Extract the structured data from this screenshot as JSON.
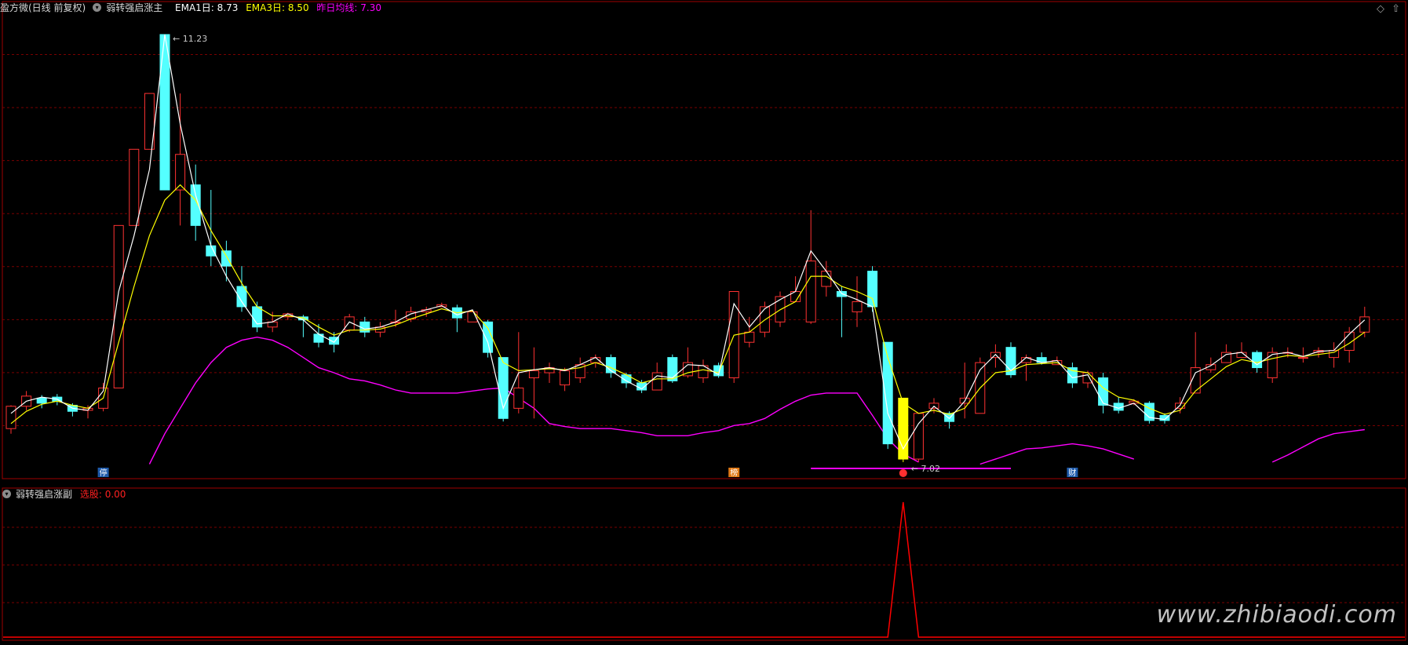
{
  "header": {
    "app_name": "盈方微(日线 前复权)",
    "main_indicator_name": "弱转强启涨主",
    "ema1_label": "EMA1日: 8.73",
    "ema3_label": "EMA3日: 8.50",
    "prev_avg_label": "昨日均线: 7.30"
  },
  "sub_header": {
    "indicator_name": "弱转强启涨副",
    "value_label": "选股: 0.00"
  },
  "watermark": "www.zhibiaodi.com",
  "colors": {
    "up": "#ff3232",
    "down": "#54ffff",
    "signal_bar": "#ffff00",
    "ema1": "#ffffff",
    "ema3": "#ffff00",
    "avg": "#ff00ff",
    "grid": "#7a0000",
    "sub_signal": "#ff0000",
    "marker_blue": "#1e5aaa",
    "marker_orange": "#e07814"
  },
  "chart_data": [
    {
      "type": "candlestick",
      "title": "弱转强启涨主",
      "annotations": [
        {
          "text": "11.23",
          "at_index": 10,
          "kind": "max"
        },
        {
          "text": "7.02",
          "at_index": 58,
          "kind": "min"
        }
      ],
      "markers": [
        {
          "text": "停",
          "at_index": 6,
          "style": "blue"
        },
        {
          "text": "榜",
          "at_index": 47,
          "style": "orange"
        },
        {
          "text": "财",
          "at_index": 69,
          "style": "blue"
        }
      ],
      "signal_line": {
        "value": 7.02,
        "from_index": 52,
        "to_index": 65
      },
      "ylim": [
        6.95,
        11.4
      ],
      "candles": [
        [
          7.35,
          7.57,
          7.3,
          7.58
        ],
        [
          7.57,
          7.67,
          7.53,
          7.72
        ],
        [
          7.65,
          7.6,
          7.55,
          7.68
        ],
        [
          7.66,
          7.62,
          7.58,
          7.69
        ],
        [
          7.58,
          7.52,
          7.47,
          7.6
        ],
        [
          7.53,
          7.55,
          7.45,
          7.58
        ],
        [
          7.55,
          7.75,
          7.52,
          7.8
        ],
        [
          7.75,
          9.35,
          7.75,
          9.35
        ],
        [
          9.35,
          10.1,
          9.35,
          10.1
        ],
        [
          10.1,
          10.65,
          10.1,
          10.65
        ],
        [
          11.23,
          9.7,
          9.7,
          11.23
        ],
        [
          9.7,
          10.05,
          9.35,
          10.65
        ],
        [
          9.75,
          9.35,
          9.2,
          9.95
        ],
        [
          9.15,
          9.05,
          8.95,
          9.7
        ],
        [
          9.1,
          8.95,
          8.8,
          9.2
        ],
        [
          8.75,
          8.55,
          8.5,
          8.95
        ],
        [
          8.55,
          8.35,
          8.3,
          8.6
        ],
        [
          8.35,
          8.4,
          8.3,
          8.5
        ],
        [
          8.45,
          8.48,
          8.42,
          8.49
        ],
        [
          8.45,
          8.42,
          8.25,
          8.47
        ],
        [
          8.28,
          8.2,
          8.15,
          8.38
        ],
        [
          8.25,
          8.18,
          8.1,
          8.3
        ],
        [
          8.32,
          8.45,
          8.3,
          8.48
        ],
        [
          8.4,
          8.3,
          8.25,
          8.45
        ],
        [
          8.3,
          8.35,
          8.25,
          8.4
        ],
        [
          8.4,
          8.4,
          8.35,
          8.52
        ],
        [
          8.43,
          8.5,
          8.4,
          8.55
        ],
        [
          8.5,
          8.52,
          8.45,
          8.55
        ],
        [
          8.55,
          8.57,
          8.55,
          8.59
        ],
        [
          8.54,
          8.44,
          8.3,
          8.57
        ],
        [
          8.4,
          8.5,
          8.42,
          8.52
        ],
        [
          8.4,
          8.1,
          8.05,
          8.42
        ],
        [
          8.05,
          7.45,
          7.42,
          8.05
        ],
        [
          7.55,
          7.75,
          7.5,
          8.3
        ],
        [
          7.85,
          7.92,
          7.45,
          8.15
        ],
        [
          7.9,
          7.95,
          7.8,
          8.0
        ],
        [
          7.78,
          7.92,
          7.72,
          7.95
        ],
        [
          7.85,
          7.98,
          7.8,
          8.05
        ],
        [
          8.0,
          8.05,
          7.95,
          8.08
        ],
        [
          8.05,
          7.9,
          7.85,
          8.08
        ],
        [
          7.88,
          7.8,
          7.75,
          7.9
        ],
        [
          7.8,
          7.73,
          7.7,
          7.83
        ],
        [
          7.73,
          7.9,
          7.73,
          8.0
        ],
        [
          8.05,
          7.82,
          7.8,
          8.08
        ],
        [
          7.87,
          8.0,
          7.85,
          8.15
        ],
        [
          7.85,
          7.97,
          7.8,
          8.03
        ],
        [
          7.97,
          7.87,
          7.85,
          8.0
        ],
        [
          7.85,
          8.7,
          7.8,
          8.7
        ],
        [
          8.2,
          8.3,
          8.15,
          8.45
        ],
        [
          8.3,
          8.55,
          8.25,
          8.6
        ],
        [
          8.4,
          8.65,
          8.35,
          8.7
        ],
        [
          8.6,
          8.7,
          8.65,
          8.85
        ],
        [
          8.4,
          9.0,
          8.38,
          9.5
        ],
        [
          8.75,
          8.9,
          8.65,
          9.0
        ],
        [
          8.7,
          8.65,
          8.25,
          8.75
        ],
        [
          8.5,
          8.6,
          8.35,
          8.85
        ],
        [
          8.9,
          8.55,
          8.5,
          8.95
        ],
        [
          8.2,
          7.2,
          7.15,
          8.2
        ],
        [
          7.65,
          7.05,
          7.02,
          7.65
        ],
        [
          7.05,
          7.5,
          7.02,
          7.5
        ],
        [
          7.55,
          7.6,
          7.5,
          7.65
        ],
        [
          7.5,
          7.42,
          7.35,
          7.52
        ],
        [
          7.6,
          7.65,
          7.45,
          8.0
        ],
        [
          7.5,
          8.0,
          7.5,
          8.05
        ],
        [
          8.05,
          8.1,
          7.95,
          8.18
        ],
        [
          8.15,
          7.88,
          7.85,
          8.2
        ],
        [
          8.0,
          8.05,
          7.82,
          8.08
        ],
        [
          8.05,
          8.0,
          7.98,
          8.1
        ],
        [
          7.98,
          8.02,
          7.98,
          8.06
        ],
        [
          7.95,
          7.8,
          7.75,
          8.0
        ],
        [
          7.8,
          7.9,
          7.75,
          7.92
        ],
        [
          7.85,
          7.58,
          7.5,
          7.9
        ],
        [
          7.6,
          7.53,
          7.5,
          7.66
        ],
        [
          7.6,
          7.62,
          7.58,
          7.64
        ],
        [
          7.6,
          7.43,
          7.4,
          7.62
        ],
        [
          7.48,
          7.43,
          7.4,
          7.5
        ],
        [
          7.55,
          7.6,
          7.5,
          7.66
        ],
        [
          7.7,
          7.95,
          7.7,
          8.3
        ],
        [
          7.93,
          7.98,
          7.9,
          8.05
        ],
        [
          8.0,
          8.1,
          8.0,
          8.18
        ],
        [
          8.05,
          8.1,
          8.05,
          8.2
        ],
        [
          8.1,
          7.95,
          7.9,
          8.12
        ],
        [
          7.85,
          8.1,
          7.8,
          8.15
        ],
        [
          8.1,
          8.1,
          8.05,
          8.15
        ],
        [
          8.05,
          8.05,
          8.0,
          8.15
        ],
        [
          8.1,
          8.12,
          8.05,
          8.15
        ],
        [
          8.05,
          8.12,
          7.95,
          8.2
        ],
        [
          8.12,
          8.3,
          8.0,
          8.35
        ],
        [
          8.3,
          8.45,
          8.25,
          8.55
        ]
      ],
      "ema1": [
        7.5,
        7.62,
        7.66,
        7.64,
        7.55,
        7.53,
        7.72,
        8.7,
        9.25,
        9.9,
        11.23,
        10.35,
        9.65,
        9.15,
        8.85,
        8.6,
        8.38,
        8.4,
        8.48,
        8.42,
        8.28,
        8.2,
        8.4,
        8.33,
        8.35,
        8.4,
        8.48,
        8.52,
        8.56,
        8.47,
        8.52,
        8.2,
        7.55,
        7.9,
        7.93,
        7.95,
        7.92,
        7.98,
        8.05,
        7.92,
        7.82,
        7.74,
        7.87,
        7.85,
        7.98,
        7.97,
        7.88,
        8.58,
        8.35,
        8.53,
        8.62,
        8.7,
        9.1,
        8.9,
        8.68,
        8.62,
        8.55,
        7.5,
        7.15,
        7.4,
        7.57,
        7.45,
        7.62,
        7.93,
        8.08,
        7.92,
        8.05,
        8.0,
        8.02,
        7.85,
        7.88,
        7.6,
        7.55,
        7.6,
        7.46,
        7.44,
        7.58,
        7.9,
        7.97,
        8.08,
        8.1,
        7.98,
        8.08,
        8.1,
        8.06,
        8.11,
        8.12,
        8.28,
        8.42
      ],
      "ema3": [
        7.4,
        7.52,
        7.59,
        7.62,
        7.58,
        7.55,
        7.65,
        8.2,
        8.75,
        9.25,
        9.6,
        9.75,
        9.6,
        9.3,
        9.05,
        8.78,
        8.55,
        8.46,
        8.46,
        8.44,
        8.35,
        8.27,
        8.32,
        8.32,
        8.33,
        8.37,
        8.43,
        8.48,
        8.53,
        8.49,
        8.51,
        8.34,
        8.0,
        7.92,
        7.93,
        7.94,
        7.93,
        7.95,
        8.0,
        7.95,
        7.88,
        7.8,
        7.84,
        7.84,
        7.9,
        7.93,
        7.9,
        8.27,
        8.3,
        8.42,
        8.52,
        8.6,
        8.85,
        8.85,
        8.75,
        8.7,
        8.63,
        8.05,
        7.6,
        7.5,
        7.53,
        7.49,
        7.55,
        7.75,
        7.9,
        7.92,
        7.98,
        7.99,
        8.0,
        7.92,
        7.9,
        7.75,
        7.66,
        7.63,
        7.55,
        7.49,
        7.53,
        7.72,
        7.84,
        7.96,
        8.03,
        8.0,
        8.04,
        8.07,
        8.06,
        8.08,
        8.1,
        8.19,
        8.3
      ],
      "prev_avg": [
        null,
        null,
        null,
        null,
        null,
        null,
        null,
        null,
        null,
        7.0,
        7.3,
        7.55,
        7.8,
        8.0,
        8.15,
        8.22,
        8.25,
        8.22,
        8.15,
        8.05,
        7.95,
        7.9,
        7.84,
        7.82,
        7.78,
        7.73,
        7.7,
        7.7,
        7.7,
        7.7,
        7.72,
        7.74,
        7.75,
        7.65,
        7.55,
        7.4,
        7.37,
        7.35,
        7.35,
        7.35,
        7.33,
        7.31,
        7.28,
        7.28,
        7.28,
        7.31,
        7.33,
        7.38,
        7.4,
        7.45,
        7.54,
        7.62,
        7.68,
        7.7,
        7.7,
        7.7,
        7.48,
        7.25,
        7.1,
        7.02,
        null,
        null,
        null,
        7.0,
        7.05,
        7.1,
        7.15,
        7.16,
        7.18,
        7.2,
        7.18,
        7.15,
        7.1,
        7.05,
        null,
        null,
        null,
        null,
        null,
        null,
        null,
        null,
        7.02,
        7.09,
        7.17,
        7.25,
        7.3,
        7.32,
        7.34
      ]
    },
    {
      "type": "line",
      "title": "弱转强启涨副",
      "series": [
        {
          "name": "选股",
          "values": [
            0,
            0,
            0,
            0,
            0,
            0,
            0,
            0,
            0,
            0,
            0,
            0,
            0,
            0,
            0,
            0,
            0,
            0,
            0,
            0,
            0,
            0,
            0,
            0,
            0,
            0,
            0,
            0,
            0,
            0,
            0,
            0,
            0,
            0,
            0,
            0,
            0,
            0,
            0,
            0,
            0,
            0,
            0,
            0,
            0,
            0,
            0,
            0,
            0,
            0,
            0,
            0,
            0,
            0,
            0,
            0,
            0,
            0,
            1,
            0,
            0,
            0,
            0,
            0,
            0,
            0,
            0,
            0,
            0,
            0,
            0,
            0,
            0,
            0,
            0,
            0,
            0,
            0,
            0,
            0,
            0,
            0,
            0,
            0,
            0,
            0,
            0,
            0,
            0
          ]
        }
      ],
      "ylim": [
        0,
        1
      ]
    }
  ]
}
